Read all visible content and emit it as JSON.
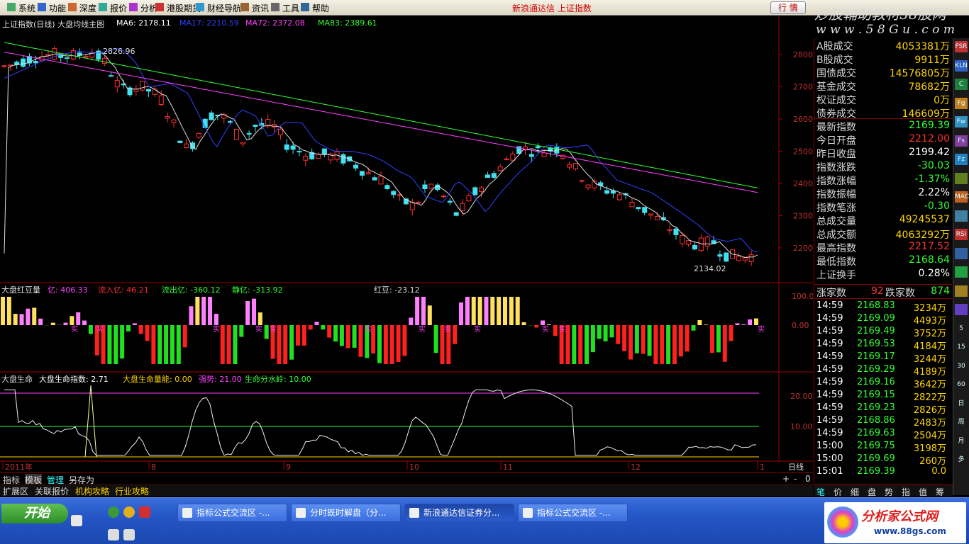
{
  "menu": {
    "items": [
      "系统",
      "功能",
      "深度",
      "报价",
      "分析",
      "港股期货",
      "财经导航",
      "资讯",
      "工具",
      "帮助"
    ],
    "title": "新浪通达信 上证指数",
    "trade_button": "行 情"
  },
  "watermark": {
    "line1": "炒股輔助教材58股网",
    "line2": "w w w . 5 8 G u . c o m"
  },
  "main_panel": {
    "title": "上证指数(日线) 大盘均线主图",
    "ma6": "MA6: 2178.11",
    "ma17": "MA17: 2210.59",
    "ma72": "MA72: 2372.08",
    "ma83": "MA83: 2389.61",
    "price_axis": [
      "2800",
      "2700",
      "2600",
      "2500",
      "2400",
      "2300",
      "2200"
    ],
    "annotation_high": "2826.96",
    "annotation_low": "2134.02"
  },
  "mid_panel": {
    "title": "大盘红豆量",
    "yi": "亿: 406.33",
    "liuru": "流入亿: 46.21",
    "liuchu": "流出亿: -360.12",
    "jing": "静亿: -313.92",
    "hongdou": "红豆: -23.12",
    "axis": [
      "100.0",
      "0.00"
    ],
    "marker": "实"
  },
  "low_panel": {
    "title": "大盘生命",
    "index": "大盘生命指数: 2.71",
    "energy": "大盘生命量能: 0.00",
    "strong": "强势: 21.00",
    "divide": "生命分水岭: 10.00",
    "axis": [
      "20.00",
      "10.00"
    ]
  },
  "xaxis": {
    "labels": [
      "2011年",
      "8",
      "9",
      "10",
      "11",
      "12",
      "1"
    ],
    "period": "日线"
  },
  "tabs1": {
    "items": [
      "指标",
      "模板",
      "管理",
      "另存为"
    ],
    "controls": [
      "+",
      "-",
      "0"
    ]
  },
  "tabs2": {
    "items": [
      "扩展区",
      "关联报价",
      "机构攻略",
      "行业攻略"
    ]
  },
  "stats": [
    {
      "label": "A股成交",
      "value": "4053381万",
      "color": "#ffd400"
    },
    {
      "label": "B股成交",
      "value": "9911万",
      "color": "#ffd400"
    },
    {
      "label": "国债成交",
      "value": "14576805万",
      "color": "#ffd400"
    },
    {
      "label": "基金成交",
      "value": "78682万",
      "color": "#ffd400"
    },
    {
      "label": "权证成交",
      "value": "0万",
      "color": "#ffd400"
    },
    {
      "label": "债券成交",
      "value": "146609万",
      "color": "#ffd400"
    },
    {
      "label": "最新指数",
      "value": "2169.39",
      "color": "#30ff30"
    },
    {
      "label": "今日开盘",
      "value": "2212.00",
      "color": "#ff3030"
    },
    {
      "label": "昨日收盘",
      "value": "2199.42",
      "color": "#ffffff"
    },
    {
      "label": "指数涨跌",
      "value": "-30.03",
      "color": "#30ff30"
    },
    {
      "label": "指数涨幅",
      "value": "-1.37%",
      "color": "#30ff30"
    },
    {
      "label": "指数振幅",
      "value": "2.22%",
      "color": "#ffffff"
    },
    {
      "label": "指数笔涨",
      "value": "-0.30",
      "color": "#30ff30"
    },
    {
      "label": "总成交量",
      "value": "49245537",
      "color": "#ffd400"
    },
    {
      "label": "总成交额",
      "value": "4063292万",
      "color": "#ffd400"
    },
    {
      "label": "最高指数",
      "value": "2217.52",
      "color": "#ff3030"
    },
    {
      "label": "最低指数",
      "value": "2168.64",
      "color": "#30ff30"
    },
    {
      "label": "上证换手",
      "value": "0.28%",
      "color": "#ffffff"
    }
  ],
  "updown": {
    "up_label": "涨家数",
    "up_value": "92",
    "down_label": "跌家数",
    "down_value": "874"
  },
  "ticks": [
    {
      "t": "14:59",
      "p": "2168.83",
      "v": "3234万"
    },
    {
      "t": "14:59",
      "p": "2169.09",
      "v": "4493万"
    },
    {
      "t": "14:59",
      "p": "2169.49",
      "v": "3752万"
    },
    {
      "t": "14:59",
      "p": "2169.53",
      "v": "4184万"
    },
    {
      "t": "14:59",
      "p": "2169.17",
      "v": "3244万"
    },
    {
      "t": "14:59",
      "p": "2169.29",
      "v": "4189万"
    },
    {
      "t": "14:59",
      "p": "2169.16",
      "v": "3642万"
    },
    {
      "t": "14:59",
      "p": "2169.15",
      "v": "2822万"
    },
    {
      "t": "14:59",
      "p": "2169.23",
      "v": "2826万"
    },
    {
      "t": "14:59",
      "p": "2168.86",
      "v": "2483万"
    },
    {
      "t": "14:59",
      "p": "2169.63",
      "v": "2504万"
    },
    {
      "t": "15:00",
      "p": "2169.75",
      "v": "3198万"
    },
    {
      "t": "15:00",
      "p": "2169.69",
      "v": "260万"
    },
    {
      "t": "15:01",
      "p": "2169.39",
      "v": "0.0"
    }
  ],
  "right_tabs": [
    "笔",
    "价",
    "细",
    "盘",
    "势",
    "指",
    "值",
    "筹"
  ],
  "sidebar": [
    "FSR",
    "KLN",
    "C",
    "Fg",
    "Fw",
    "Fs",
    "Fz",
    "",
    "MACD",
    "",
    "RSI",
    "",
    "",
    "",
    "",
    "5",
    "15",
    "30",
    "60",
    "日",
    "周",
    "月",
    "多"
  ],
  "taskbar": {
    "start": "开始",
    "buttons": [
      "指标公式交流区 -...",
      "分时既时解盘（分...",
      "新浪通达信证券分...",
      "指标公式交流区 -..."
    ],
    "logo": "分析家公式网",
    "logo_url": "www.88gs.com"
  }
}
